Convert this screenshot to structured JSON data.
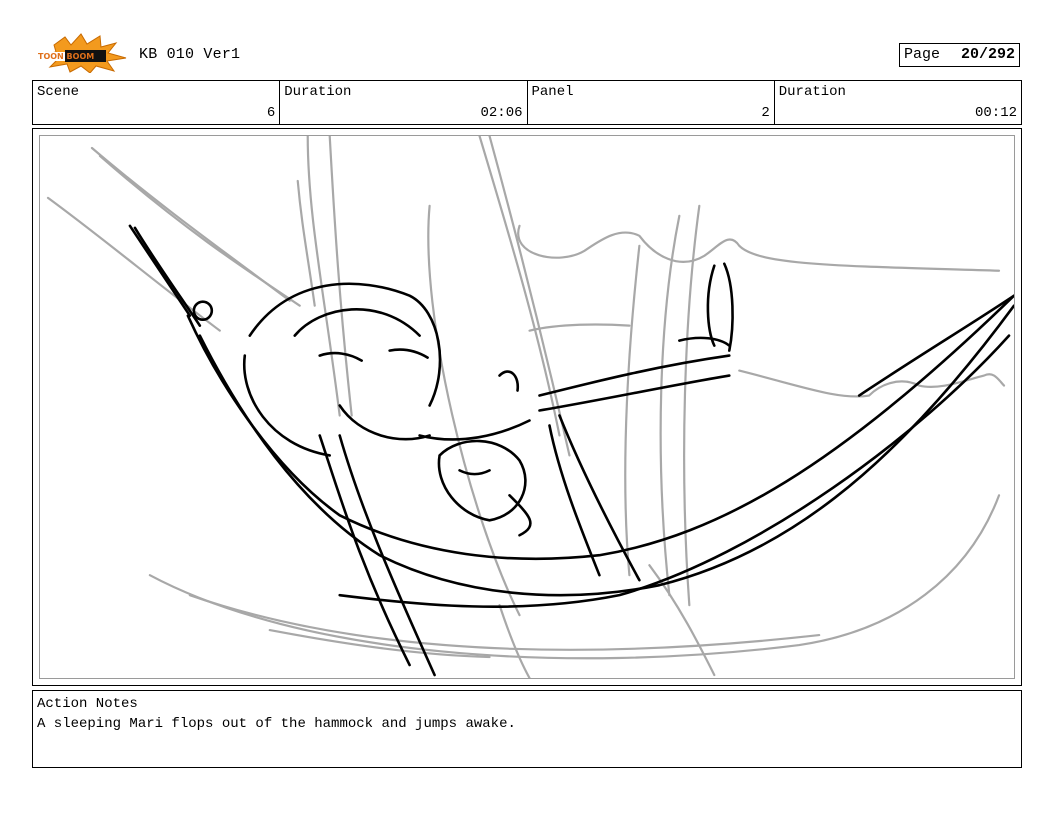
{
  "header": {
    "logo_text": "TOON BOOM",
    "title": "KB 010 Ver1",
    "page_label": "Page",
    "page_value": "20/292"
  },
  "info": {
    "scene_label": "Scene",
    "scene_value": "6",
    "duration1_label": "Duration",
    "duration1_value": "02:06",
    "panel_label": "Panel",
    "panel_value": "2",
    "duration2_label": "Duration",
    "duration2_value": "00:12"
  },
  "notes": {
    "label": "Action Notes",
    "text": "A sleeping Mari flops out of the hammock and jumps awake."
  },
  "colors": {
    "ink": "#000000",
    "sketch_gray": "#a8a8a8",
    "logo_orange": "#f39a1e"
  }
}
